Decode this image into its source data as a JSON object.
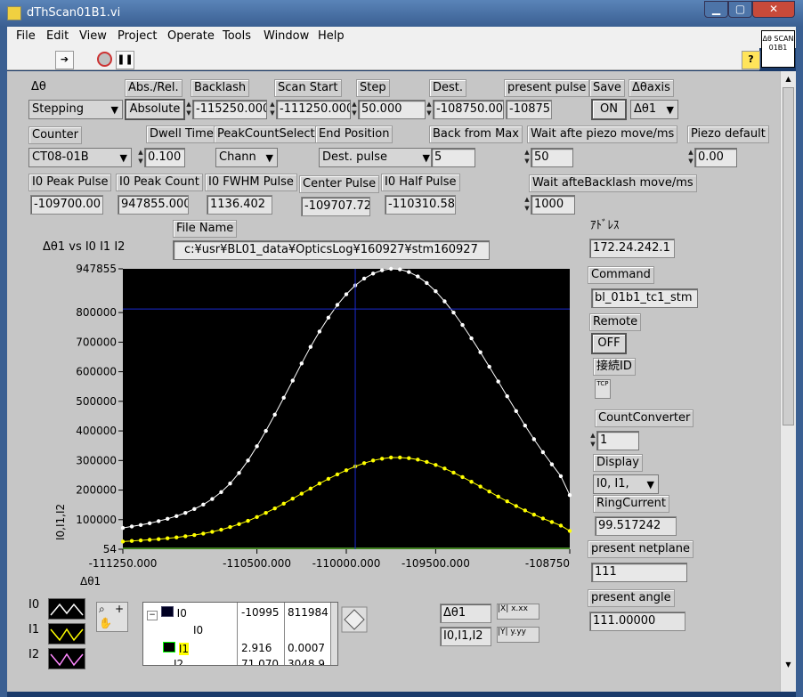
{
  "window": {
    "title": "dThScan01B1.vi",
    "min_label": "▁",
    "max_label": "▢",
    "close_label": "✕"
  },
  "menu": [
    "File",
    "Edit",
    "View",
    "Project",
    "Operate",
    "Tools",
    "Window",
    "Help"
  ],
  "help_button": "?",
  "logo_text": "Δθ SCAN 01B1",
  "controls": {
    "dtheta_label": "Δθ",
    "dtheta_value": "Stepping",
    "absrel_label": "Abs./Rel.",
    "absrel_value": "Absolute",
    "backlash_label": "Backlash",
    "backlash_value": "-115250.000",
    "scanstart_label": "Scan Start",
    "scanstart_value": "-111250.000",
    "step_label": "Step",
    "step_value": "50.000",
    "dest_label": "Dest.",
    "dest_value": "-108750.00",
    "presentpulse_label": "present pulse",
    "presentpulse_value": "-10875",
    "save_label": "Save",
    "save_value": "ON",
    "axis_label": "Δθaxis",
    "axis_value": "Δθ1",
    "counter_label": "Counter",
    "counter_value": "CT08-01B",
    "dwell_label": "Dwell Time",
    "dwell_value": "0.100",
    "peakcount_label": "PeakCountSelect",
    "peakcount_value": "Chann",
    "endpos_label": "End Position",
    "endpos_value": "Dest. pulse",
    "backfrom_label": "Back from Max",
    "backfrom_value": "5",
    "waitpiezo_label": "Wait afte piezo move/ms",
    "waitpiezo_value": "50",
    "piezodef_label": "Piezo default",
    "piezodef_value": "0.00",
    "i0peakpulse_label": "I0 Peak Pulse",
    "i0peakpulse_value": "-109700.00",
    "i0peakcount_label": "I0 Peak Count",
    "i0peakcount_value": "947855.000",
    "i0fwhm_label": "I0 FWHM Pulse",
    "i0fwhm_value": "1136.402",
    "center_label": "Center Pulse",
    "center_value": "-109707.72",
    "i0half_label": "I0 Half Pulse",
    "i0half_value": "-110310.58",
    "waitback_label": "Wait afteBacklash move/ms",
    "waitback_value": "1000",
    "filename_label": "File Name",
    "filename_value": "c:¥usr¥BL01_data¥OpticsLog¥160927¥stm160927",
    "address_label": "ｱﾄﾞﾚｽ",
    "address_value": "172.24.242.1",
    "command_label": "Command",
    "command_value": "bl_01b1_tc1_stm",
    "remote_label": "Remote",
    "remote_value": "OFF",
    "connid_label": "接続ID",
    "tcp_label": "TCP",
    "countconv_label": "CountConverter",
    "countconv_value": "1",
    "display_label": "Display",
    "display_value": "I0, I1,",
    "ring_label": "RingCurrent",
    "ring_value": "99.517242",
    "netplane_label": "present netplane",
    "netplane_value": "111",
    "angle_label": "present angle",
    "angle_value": "111.00000"
  },
  "graph": {
    "title": "Δθ1 vs I0  I1  I2",
    "cursor_x": "Δθ1",
    "cursor_y": "I0,I1,I2"
  },
  "legend": [
    {
      "name": "I0",
      "color": "#ffffff"
    },
    {
      "name": "I1",
      "color": "#ffff00"
    },
    {
      "name": "I2",
      "color": "#ff80ff"
    }
  ],
  "cursor_table": {
    "rows": [
      {
        "name": "I0",
        "x": "-10995",
        "y": "811984"
      },
      {
        "name": "I0",
        "x": "",
        "y": ""
      },
      {
        "name": "I1",
        "x": "2.916",
        "y": "0.0007"
      },
      {
        "name": "I2",
        "x": "71.070",
        "y": "3048.9"
      }
    ]
  },
  "chart_data": {
    "type": "scatter",
    "title": "Δθ1 vs I0  I1  I2",
    "xlabel": "Δθ1",
    "ylabel": "I0,I1,I2",
    "xlim": [
      -111250,
      -108750
    ],
    "ylim": [
      54,
      947855
    ],
    "x_ticks": [
      "-111250.000",
      "-110500.000",
      "-110000.000",
      "-109500.000",
      "-108750"
    ],
    "y_ticks": [
      "947855",
      "800000",
      "700000",
      "600000",
      "500000",
      "400000",
      "300000",
      "200000",
      "100000",
      "54"
    ],
    "cursor": {
      "x": -109950,
      "y": 811984
    },
    "series": [
      {
        "name": "I0",
        "color": "#ffffff",
        "points": [
          [
            -111250,
            72000
          ],
          [
            -111200,
            77000
          ],
          [
            -111150,
            82000
          ],
          [
            -111100,
            88000
          ],
          [
            -111050,
            95000
          ],
          [
            -111000,
            103000
          ],
          [
            -110950,
            112000
          ],
          [
            -110900,
            123000
          ],
          [
            -110850,
            136000
          ],
          [
            -110800,
            151000
          ],
          [
            -110750,
            170000
          ],
          [
            -110700,
            193000
          ],
          [
            -110650,
            222000
          ],
          [
            -110600,
            258000
          ],
          [
            -110550,
            300000
          ],
          [
            -110500,
            348000
          ],
          [
            -110450,
            400000
          ],
          [
            -110400,
            455000
          ],
          [
            -110350,
            512000
          ],
          [
            -110300,
            570000
          ],
          [
            -110250,
            628000
          ],
          [
            -110200,
            684000
          ],
          [
            -110150,
            736000
          ],
          [
            -110100,
            783000
          ],
          [
            -110050,
            826000
          ],
          [
            -110000,
            862000
          ],
          [
            -109950,
            892000
          ],
          [
            -109900,
            915000
          ],
          [
            -109850,
            932000
          ],
          [
            -109800,
            943000
          ],
          [
            -109750,
            947855
          ],
          [
            -109700,
            946000
          ],
          [
            -109650,
            937000
          ],
          [
            -109600,
            922000
          ],
          [
            -109550,
            900000
          ],
          [
            -109500,
            872000
          ],
          [
            -109450,
            838000
          ],
          [
            -109400,
            800000
          ],
          [
            -109350,
            758000
          ],
          [
            -109300,
            713000
          ],
          [
            -109250,
            666000
          ],
          [
            -109200,
            617000
          ],
          [
            -109150,
            567000
          ],
          [
            -109100,
            517000
          ],
          [
            -109050,
            467000
          ],
          [
            -109000,
            418000
          ],
          [
            -108950,
            372000
          ],
          [
            -108900,
            328000
          ],
          [
            -108850,
            287000
          ],
          [
            -108800,
            247000
          ],
          [
            -108750,
            183000
          ]
        ]
      },
      {
        "name": "I1",
        "color": "#ffff00",
        "points": [
          [
            -111250,
            26000
          ],
          [
            -111200,
            28000
          ],
          [
            -111150,
            30000
          ],
          [
            -111100,
            32000
          ],
          [
            -111050,
            34000
          ],
          [
            -111000,
            37000
          ],
          [
            -110950,
            40000
          ],
          [
            -110900,
            44000
          ],
          [
            -110850,
            48000
          ],
          [
            -110800,
            53000
          ],
          [
            -110750,
            59000
          ],
          [
            -110700,
            66000
          ],
          [
            -110650,
            75000
          ],
          [
            -110600,
            85000
          ],
          [
            -110550,
            96000
          ],
          [
            -110500,
            109000
          ],
          [
            -110450,
            123000
          ],
          [
            -110400,
            138000
          ],
          [
            -110350,
            154000
          ],
          [
            -110300,
            171000
          ],
          [
            -110250,
            188000
          ],
          [
            -110200,
            205000
          ],
          [
            -110150,
            222000
          ],
          [
            -110100,
            238000
          ],
          [
            -110050,
            253000
          ],
          [
            -110000,
            267000
          ],
          [
            -109950,
            280000
          ],
          [
            -109900,
            291000
          ],
          [
            -109850,
            300000
          ],
          [
            -109800,
            306000
          ],
          [
            -109750,
            310000
          ],
          [
            -109700,
            310000
          ],
          [
            -109650,
            308000
          ],
          [
            -109600,
            303000
          ],
          [
            -109550,
            295000
          ],
          [
            -109500,
            285000
          ],
          [
            -109450,
            273000
          ],
          [
            -109400,
            259000
          ],
          [
            -109350,
            244000
          ],
          [
            -109300,
            228000
          ],
          [
            -109250,
            212000
          ],
          [
            -109200,
            195000
          ],
          [
            -109150,
            178000
          ],
          [
            -109100,
            162000
          ],
          [
            -109050,
            146000
          ],
          [
            -109000,
            131000
          ],
          [
            -108950,
            117000
          ],
          [
            -108900,
            104000
          ],
          [
            -108850,
            92000
          ],
          [
            -108800,
            80000
          ],
          [
            -108750,
            62000
          ]
        ]
      },
      {
        "name": "I2",
        "color": "#80ff40",
        "points": [
          [
            -111250,
            3000
          ],
          [
            -110750,
            3000
          ],
          [
            -110250,
            3000
          ],
          [
            -109750,
            3000
          ],
          [
            -109250,
            3000
          ],
          [
            -108750,
            3000
          ]
        ]
      }
    ]
  }
}
